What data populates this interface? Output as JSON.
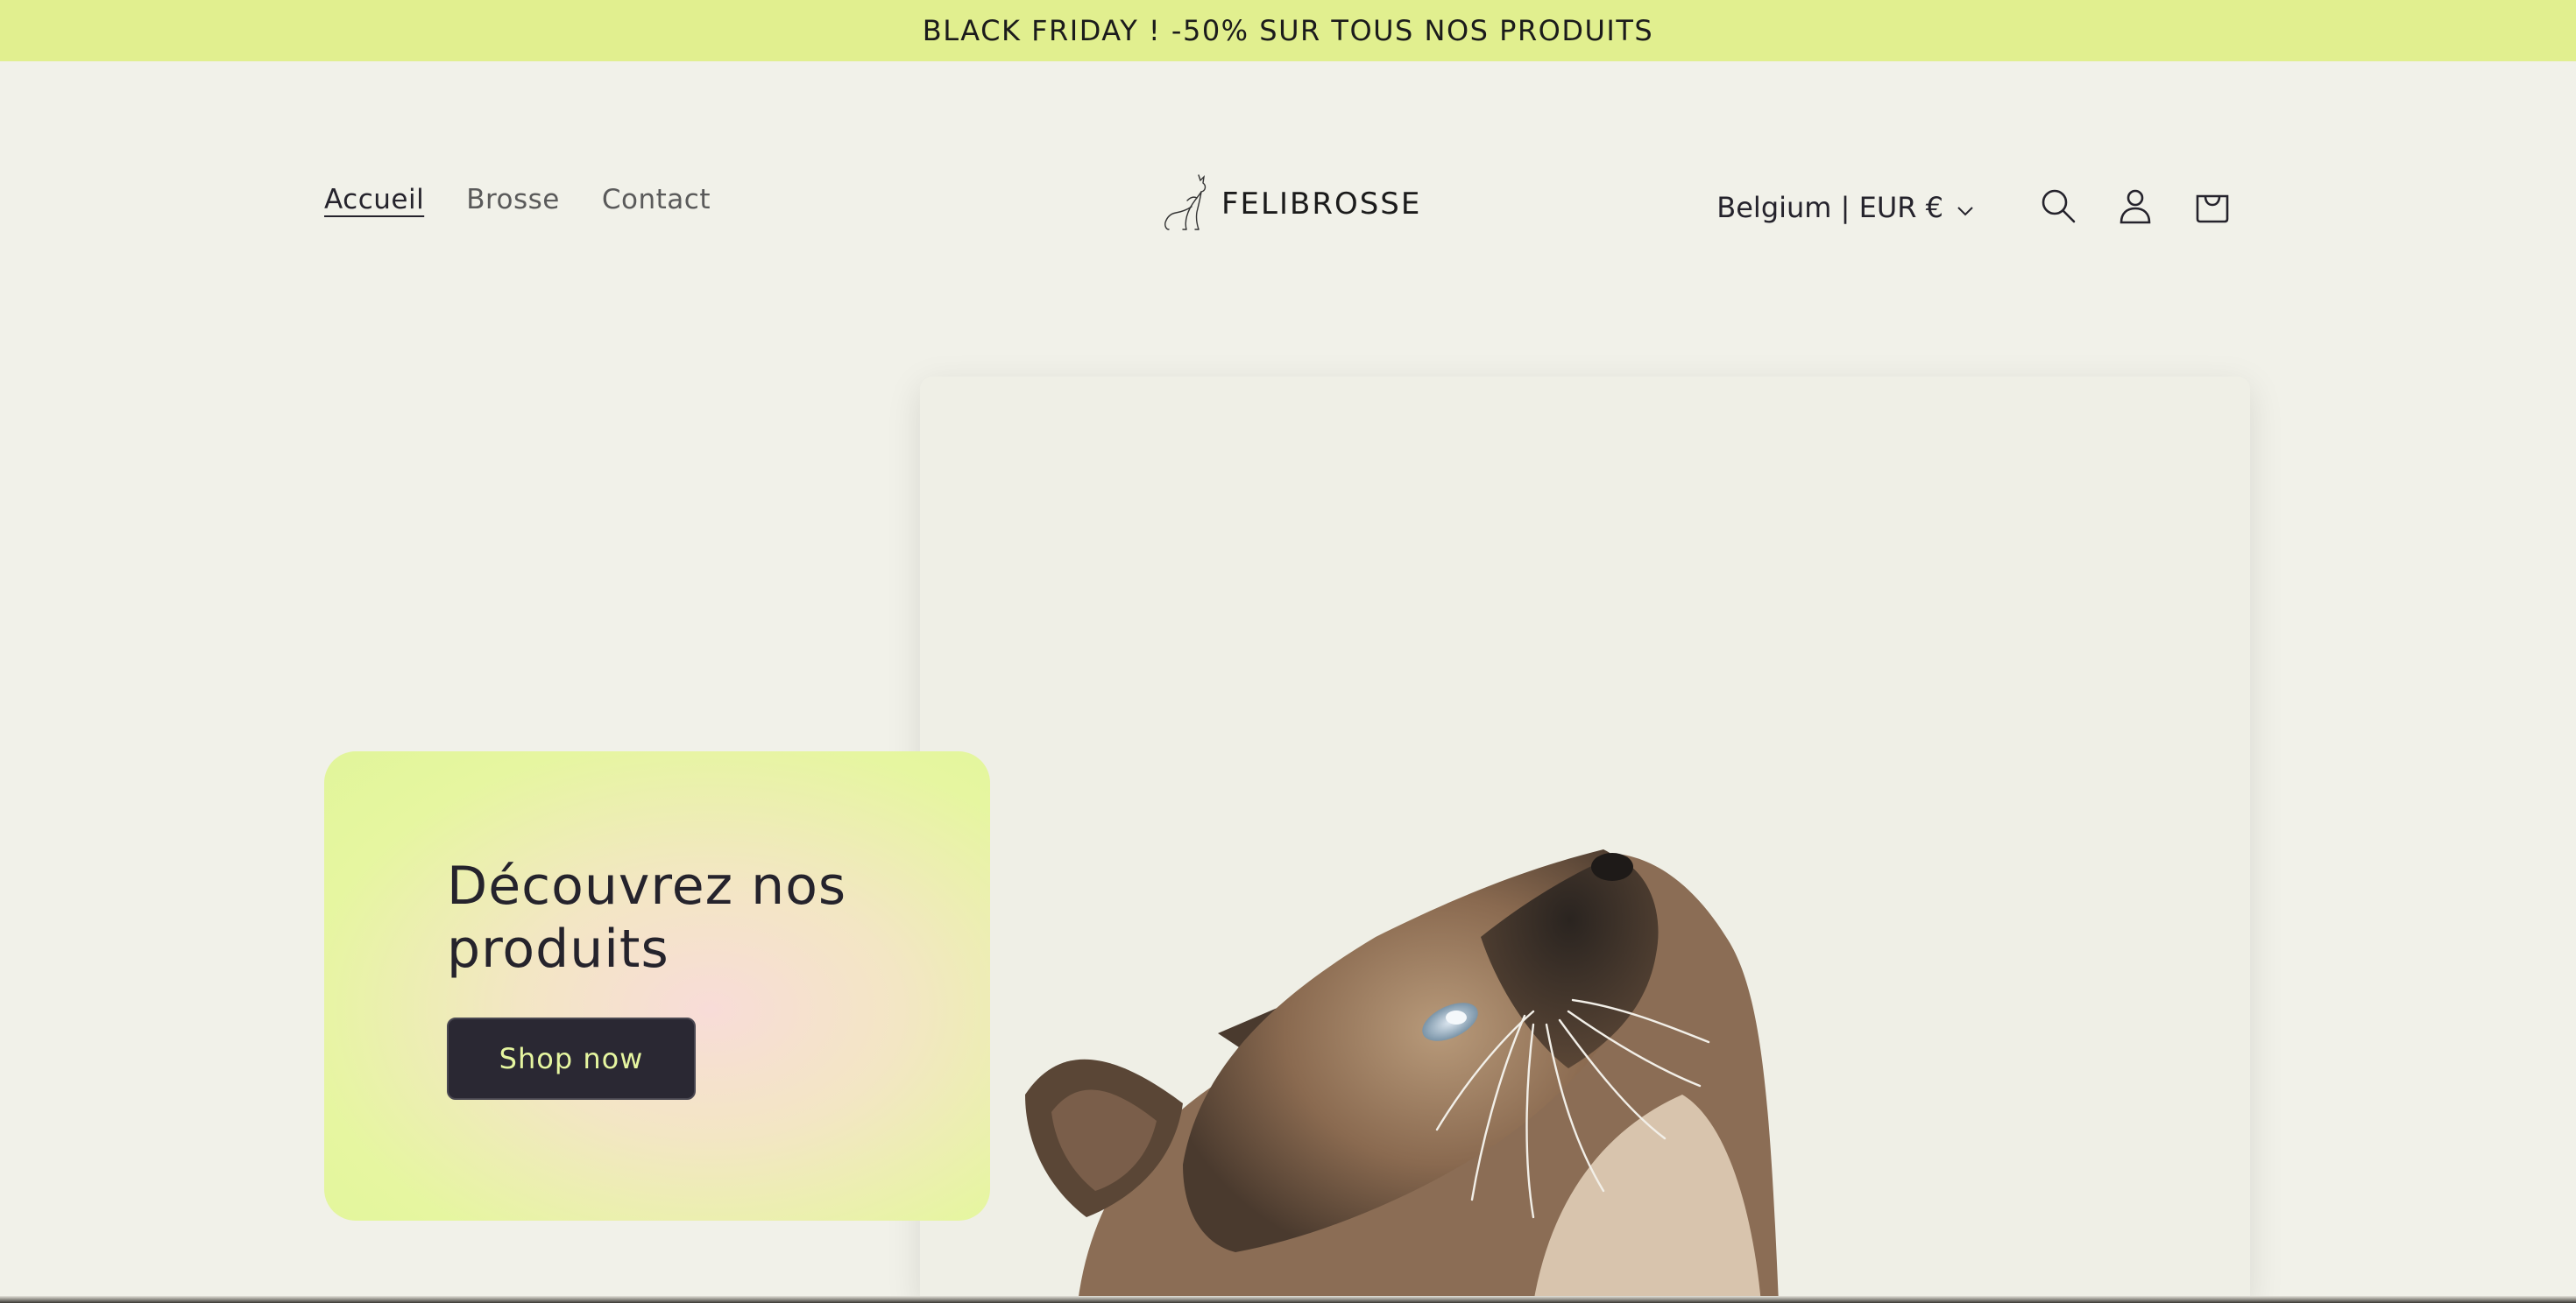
{
  "announcement": "BLACK FRIDAY ! -50% SUR TOUS NOS PRODUITS",
  "nav": {
    "items": [
      {
        "label": "Accueil",
        "active": true
      },
      {
        "label": "Brosse",
        "active": false
      },
      {
        "label": "Contact",
        "active": false
      }
    ]
  },
  "logo": {
    "text": "FELIBROSSE",
    "icon": "cat-logo-icon"
  },
  "header": {
    "locale": "Belgium | EUR €",
    "icons": [
      "chevron-down-icon",
      "search-icon",
      "account-icon",
      "cart-icon"
    ]
  },
  "hero": {
    "title": "Découvrez nos produits",
    "button_label": "Shop now",
    "image": "siamese-cat-looking-up"
  },
  "colors": {
    "announcement_bg": "#e1ef8f",
    "page_bg": "#f1f1e9",
    "button_bg": "#2a2833",
    "button_text": "#e6f6a0",
    "text": "#25232c"
  }
}
